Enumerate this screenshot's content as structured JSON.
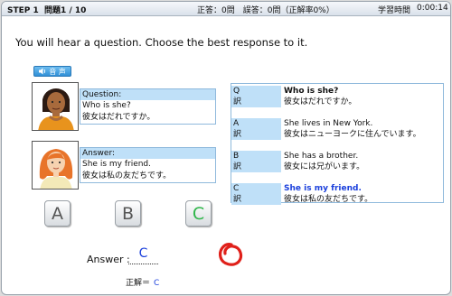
{
  "header": {
    "step": "STEP 1",
    "question_no": "問題1 / 10",
    "score": "正答：0問　誤答：0問（正解率0%）",
    "time_label": "学習時間",
    "time_value": "0:00:14"
  },
  "instruction": "You will hear a question. Choose the best response to it.",
  "audio_button": {
    "label": "音 声",
    "icon": "speaker-icon"
  },
  "question_card": {
    "label": "Question:",
    "english": "Who is she?",
    "japanese": "彼女はだれですか。"
  },
  "answer_card": {
    "label": "Answer:",
    "english": "She is my friend.",
    "japanese": "彼女は私の友だちです。"
  },
  "choices": [
    "A",
    "B",
    "C"
  ],
  "selected_choice": "C",
  "table": {
    "rows": [
      {
        "key": "Q",
        "value": "Who is she?"
      },
      {
        "key": "訳",
        "value": "彼女はだれですか。"
      },
      {
        "key": "A",
        "value": "She lives in New York."
      },
      {
        "key": "訳",
        "value": "彼女はニューヨークに住んでいます。"
      },
      {
        "key": "B",
        "value": "She has a brother."
      },
      {
        "key": "訳",
        "value": "彼女には兄がいます。"
      },
      {
        "key": "C",
        "value": "She is my friend."
      },
      {
        "key": "訳",
        "value": "彼女は私の友だちです。"
      }
    ]
  },
  "answer": {
    "label": "Answer :",
    "value": "C"
  },
  "correct": {
    "label": "正解＝",
    "value": "C"
  },
  "result_mark": "correct-circle-icon",
  "colors": {
    "accent_blue": "#1a3fdc",
    "header_cell": "#bfe0f8",
    "correct_green": "#2fb64a",
    "result_red": "#e0201a"
  }
}
